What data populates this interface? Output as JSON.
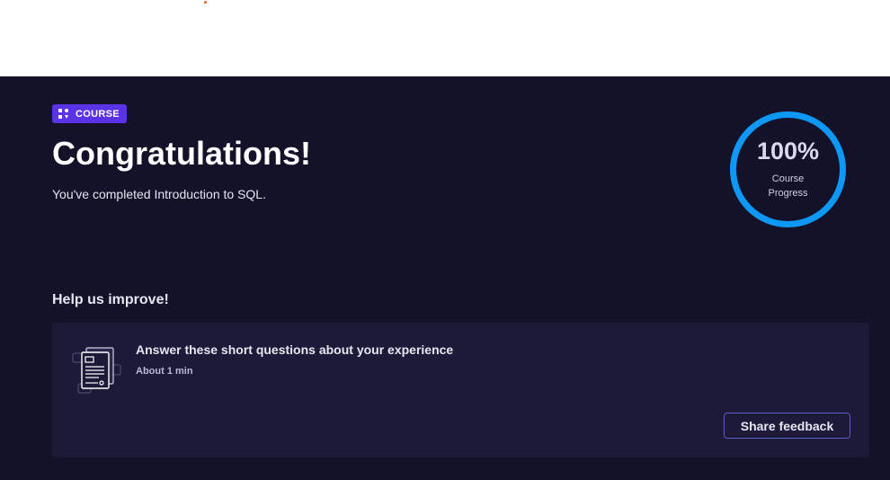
{
  "badge": {
    "label": "COURSE",
    "icon": "course-grid-icon"
  },
  "hero": {
    "title": "Congratulations!",
    "subtitle": "You've completed Introduction to SQL."
  },
  "progress": {
    "value": "100%",
    "label": "Course Progress",
    "fraction": 1.0,
    "ring_color": "#0d98f5"
  },
  "feedback": {
    "heading": "Help us improve!",
    "card_title": "Answer these short questions about your experience",
    "duration": "About 1 min",
    "button_label": "Share feedback",
    "icon": "survey-document-icon"
  },
  "colors": {
    "background": "#141228",
    "card": "#1c1a38",
    "accent": "#5b33e6",
    "button_border": "#5a5ccc"
  }
}
